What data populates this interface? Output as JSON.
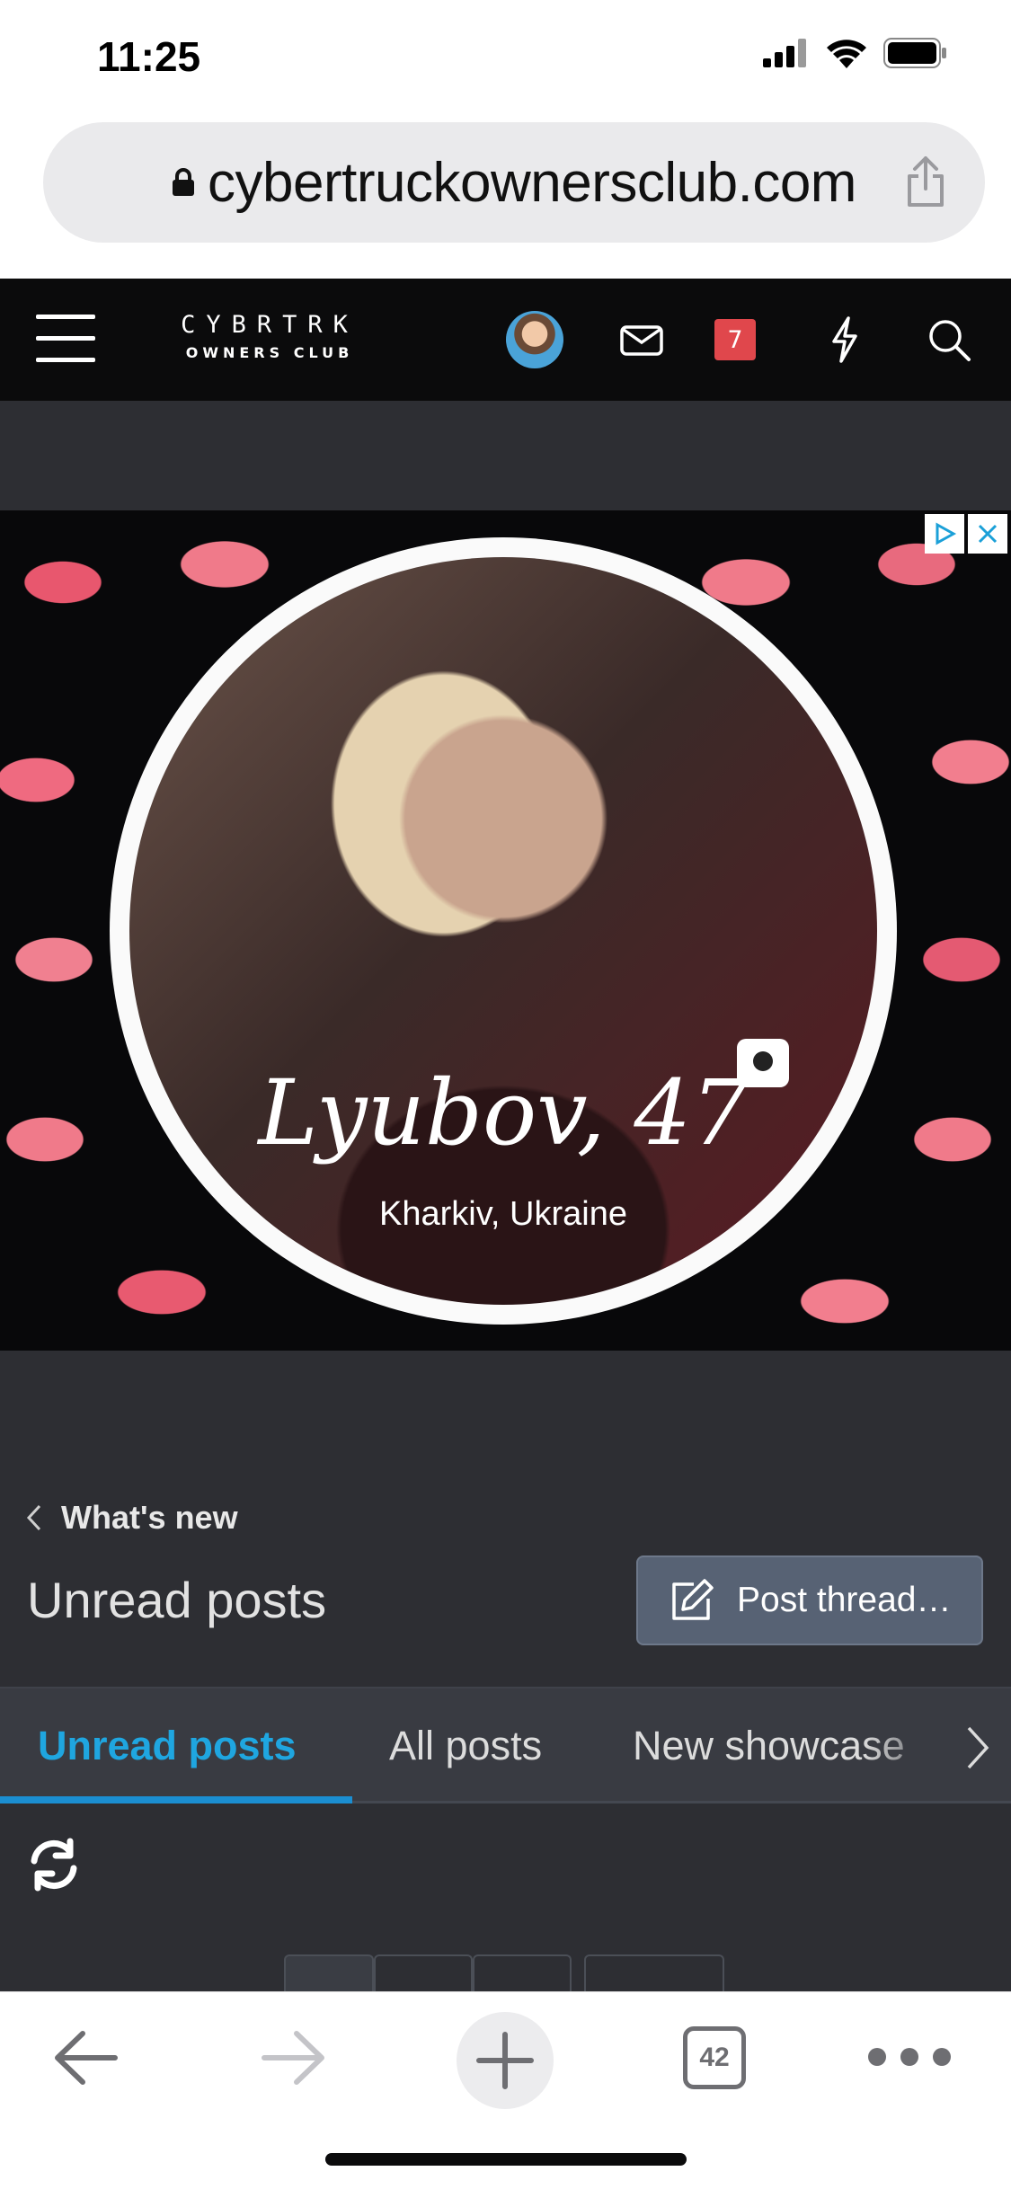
{
  "status_bar": {
    "time": "11:25"
  },
  "browser": {
    "url": "cybertruckownersclub.com",
    "tabs_count": "42"
  },
  "site_header": {
    "logo_top": "CYBRTRK",
    "logo_bottom": "OWNERS CLUB",
    "notifications_count": "7"
  },
  "ad": {
    "name": "Lyubov, 47",
    "location": "Kharkiv, Ukraine"
  },
  "page": {
    "breadcrumb": "What's new",
    "title": "Unread posts",
    "post_button": "Post thread…",
    "tabs": [
      "Unread posts",
      "All posts",
      "New showcase"
    ]
  },
  "colors": {
    "accent": "#1fa6e0",
    "header_bg": "#0b0b0c",
    "page_bg": "#2d2e33",
    "badge": "#e0474c"
  }
}
